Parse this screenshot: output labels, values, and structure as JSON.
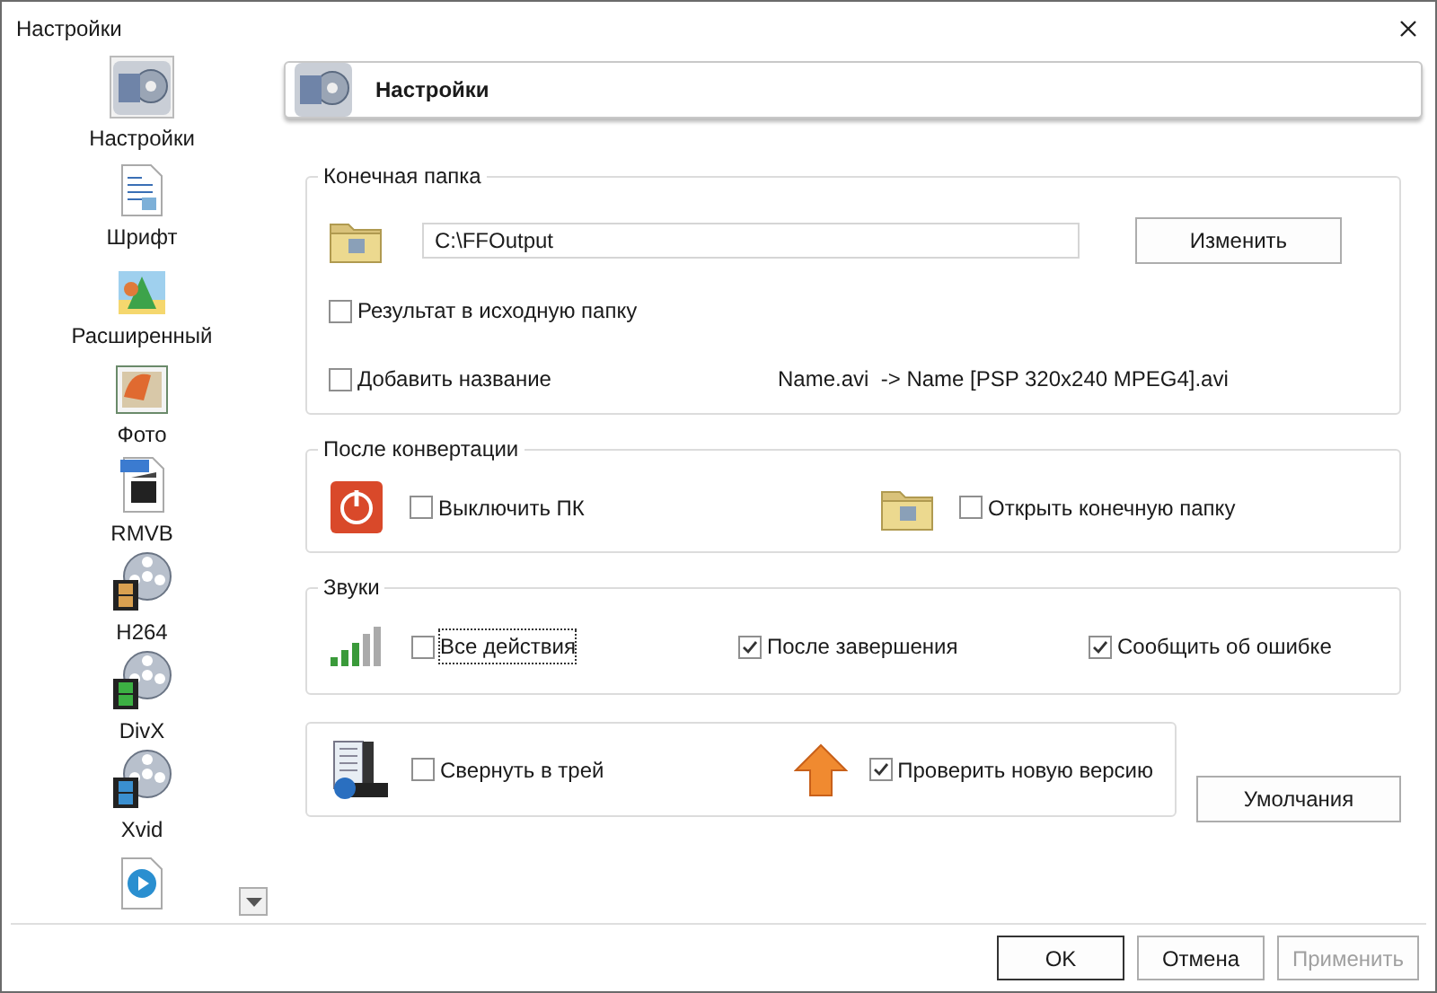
{
  "window": {
    "title": "Настройки"
  },
  "sidebar": {
    "items": [
      {
        "kind": "settings",
        "label": "Настройки",
        "selected": true
      },
      {
        "kind": "font",
        "label": "Шрифт",
        "selected": false
      },
      {
        "kind": "advanced",
        "label": "Расширенный",
        "selected": false
      },
      {
        "kind": "photo",
        "label": "Фото",
        "selected": false
      },
      {
        "kind": "rmvb",
        "label": "RMVB",
        "selected": false
      },
      {
        "kind": "film",
        "label": "H264",
        "selected": false,
        "color": "#d9a050"
      },
      {
        "kind": "film",
        "label": "DivX",
        "selected": false,
        "color": "#3cb043"
      },
      {
        "kind": "film",
        "label": "Xvid",
        "selected": false,
        "color": "#3a8fd0"
      },
      {
        "kind": "media",
        "selected": false
      }
    ]
  },
  "header": {
    "title": "Настройки"
  },
  "output_folder": {
    "legend": "Конечная папка",
    "path": "C:\\FFOutput",
    "change_button": "Изменить",
    "checkboxes": [
      {
        "label": "Результат в исходную папку",
        "checked": false
      },
      {
        "label": "Добавить название",
        "checked": false
      }
    ],
    "name_example": "Name.avi  -> Name [PSP 320x240 MPEG4].avi"
  },
  "after_conversion": {
    "legend": "После конвертации",
    "items": [
      {
        "kind": "power",
        "label": "Выключить ПК",
        "checked": false
      },
      {
        "kind": "folder",
        "label": "Открыть конечную папку",
        "checked": false
      }
    ]
  },
  "sounds": {
    "legend": "Звуки",
    "items": [
      {
        "label": "Все действия",
        "checked": false,
        "focused": true
      },
      {
        "label": "После завершения",
        "checked": true,
        "focused": false
      },
      {
        "label": "Сообщить об ошибке",
        "checked": true,
        "focused": false
      }
    ]
  },
  "misc": {
    "items": [
      {
        "kind": "tray",
        "label": "Свернуть в трей",
        "checked": false
      },
      {
        "kind": "update",
        "label": "Проверить новую версию",
        "checked": true
      }
    ]
  },
  "defaults_button": "Умолчания",
  "footer": {
    "buttons": [
      {
        "label": "OK",
        "disabled": false
      },
      {
        "label": "Отмена",
        "disabled": false
      },
      {
        "label": "Применить",
        "disabled": true
      }
    ]
  }
}
